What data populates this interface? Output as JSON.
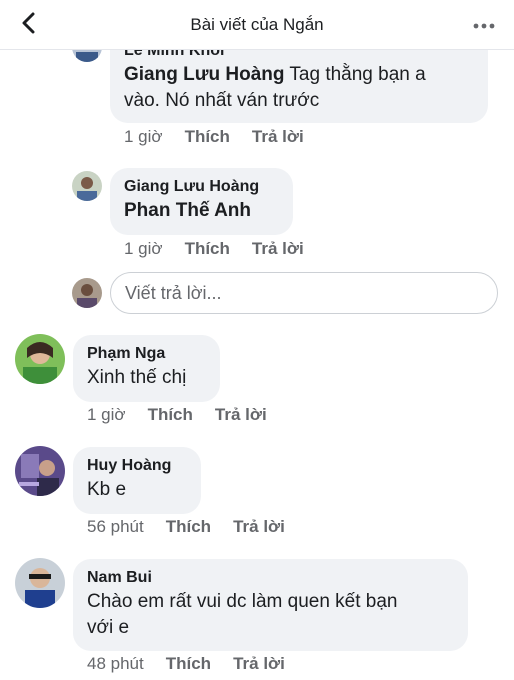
{
  "header": {
    "title": "Bài viết của Ngắn"
  },
  "comments": [
    {
      "author_cut": "Lê Minh Khôi",
      "inline_author": "Giang Lưu Hoàng",
      "text_rest": " Tag thằng bạn a",
      "text_line2": "vào. Nó nhất ván trước",
      "time": "1 giờ",
      "like": "Thích",
      "reply": "Trả lời"
    },
    {
      "author": "Giang Lưu Hoàng",
      "text": "Phan Thế Anh",
      "time": "1 giờ",
      "like": "Thích",
      "reply": "Trả lời"
    },
    {
      "author": "Phạm Nga",
      "text": "Xinh thế chị",
      "time": "1 giờ",
      "like": "Thích",
      "reply": "Trả lời"
    },
    {
      "author": "Huy Hoàng",
      "text": "Kb e",
      "time": "56 phút",
      "like": "Thích",
      "reply": "Trả lời"
    },
    {
      "author": "Nam Bui",
      "text_line1": "Chào em rất vui dc làm quen kết bạn",
      "text_line2": "với e",
      "time": "48 phút",
      "like": "Thích",
      "reply": "Trả lời"
    }
  ],
  "reply_box": {
    "placeholder": "Viết trả lời..."
  },
  "colors": {
    "bubble": "#f0f2f5",
    "meta_text": "#65676b",
    "text": "#1c1e21"
  },
  "icons": {
    "back": "chevron-left-icon",
    "more": "more-dots-icon"
  }
}
